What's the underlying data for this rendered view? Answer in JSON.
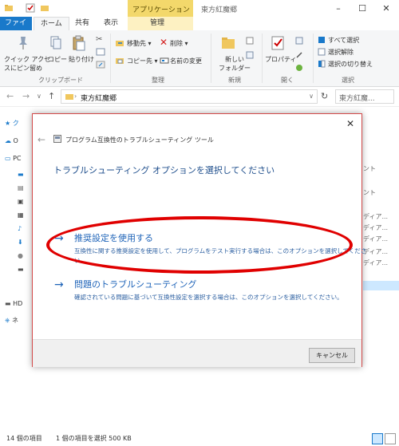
{
  "window": {
    "context_tab": "アプリケーション ツール",
    "title": "東方紅魔郷"
  },
  "ribbon_tabs": {
    "file": "ファイル",
    "home": "ホーム",
    "share": "共有",
    "view": "表示",
    "manage": "管理"
  },
  "ribbon": {
    "clipboard": {
      "pin": "クイック アクセスにピン留め",
      "pin1": "クイック アクセ",
      "pin2": "スにピン留め",
      "copy": "コピー",
      "paste": "貼り付け",
      "label": "クリップボード"
    },
    "organize": {
      "move": "移動先 ▾",
      "copy_to": "コピー先 ▾",
      "delete": "削除 ▾",
      "rename": "名前の変更",
      "label": "整理"
    },
    "new": {
      "folder1": "新しい",
      "folder2": "フォルダー",
      "label": "新規"
    },
    "open": {
      "properties": "プロパティ",
      "label": "開く"
    },
    "select": {
      "select_all": "すべて選択",
      "select_none": "選択解除",
      "invert": "選択の切り替え",
      "label": "選択"
    }
  },
  "address": {
    "path": "東方紅魔郷",
    "search_placeholder": "東方紅魔..."
  },
  "nav": {
    "quick": "ク",
    "onedrive": "O",
    "pc": "PC",
    "hd": "HD",
    "network": "ネ"
  },
  "list_right": [
    "ント",
    "ント",
    "ディア...",
    "ディア...",
    "ディア...",
    "ディア...",
    "ディア..."
  ],
  "status": {
    "count": "14 個の項目",
    "selected": "1 個の項目を選択  500 KB"
  },
  "dialog": {
    "title": "プログラム互換性のトラブルシューティング ツール",
    "heading": "トラブルシューティング オプションを選択してください",
    "option1": {
      "title": "推奨設定を使用する",
      "desc1": "互換性に関する推奨設定を使用して、プログラムをテスト実行する場合は、このオプションを選択してくださ",
      "desc2": "い。"
    },
    "option2": {
      "title": "問題のトラブルシューティング",
      "desc": "確認されている問題に基づいて互換性設定を選択する場合は、このオプションを選択してください。"
    },
    "cancel": "キャンセル"
  },
  "colors": {
    "accent": "#1979ca",
    "highlight": "#e00000",
    "link": "#1e63b8"
  }
}
